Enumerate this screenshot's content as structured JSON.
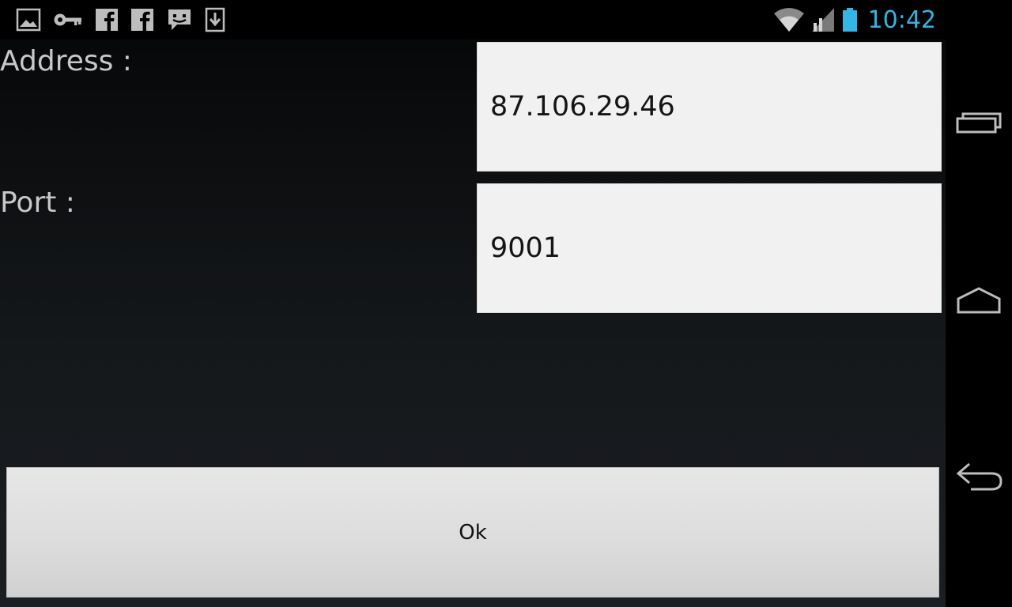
{
  "status_bar": {
    "notification_icons": [
      "image-icon",
      "key-icon",
      "facebook-icon",
      "facebook-icon",
      "chat-icon",
      "download-icon"
    ],
    "system_icons": [
      "wifi-icon",
      "signal-icon",
      "battery-icon"
    ],
    "time": "10:42",
    "time_color": "#33b5e5"
  },
  "form": {
    "address_label": "Address :",
    "address_value": "87.106.29.46",
    "port_label": "Port :",
    "port_value": "9001"
  },
  "actions": {
    "ok_label": "Ok"
  },
  "nav_bar": {
    "buttons": [
      "recent-apps-icon",
      "home-icon",
      "back-icon"
    ]
  }
}
